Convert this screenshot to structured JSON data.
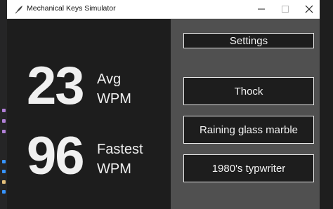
{
  "window": {
    "title": "Mechanical Keys Simulator",
    "icon": "feather-icon"
  },
  "stats": {
    "avg": {
      "value": "23",
      "label_line1": "Avg",
      "label_line2": "WPM"
    },
    "fastest": {
      "value": "96",
      "label_line1": "Fastest",
      "label_line2": "WPM"
    }
  },
  "buttons": {
    "settings": "Settings",
    "sound1": "Thock",
    "sound2": "Raining glass marble",
    "sound3": "1980's typwriter"
  },
  "colors": {
    "left_panel": "#1d1d1d",
    "right_panel": "#505050",
    "button_bg": "#1d1d1d",
    "button_border": "#e6e6e6",
    "text": "#f0f0f0"
  }
}
